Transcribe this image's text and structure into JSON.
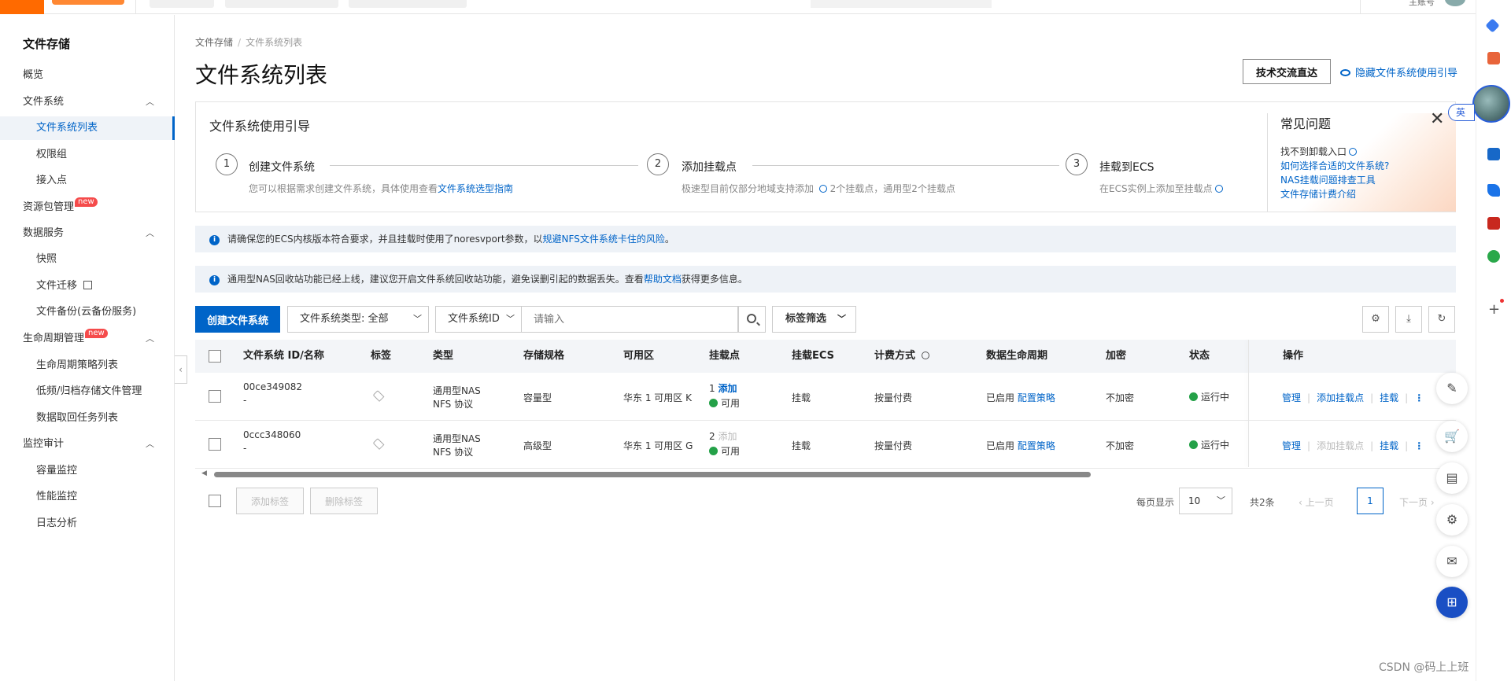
{
  "topbar": {
    "account_label": "主账号"
  },
  "sidebar": {
    "title": "文件存储",
    "items": [
      {
        "label": "概览"
      },
      {
        "label": "文件系统"
      },
      {
        "label": "文件系统列表"
      },
      {
        "label": "权限组"
      },
      {
        "label": "接入点"
      },
      {
        "label": "资源包管理",
        "badge": "new"
      },
      {
        "label": "数据服务"
      },
      {
        "label": "快照"
      },
      {
        "label": "文件迁移"
      },
      {
        "label": "文件备份(云备份服务)"
      },
      {
        "label": "生命周期管理",
        "badge": "new"
      },
      {
        "label": "生命周期策略列表"
      },
      {
        "label": "低频/归档存储文件管理"
      },
      {
        "label": "数据取回任务列表"
      },
      {
        "label": "监控审计"
      },
      {
        "label": "容量监控"
      },
      {
        "label": "性能监控"
      },
      {
        "label": "日志分析"
      }
    ]
  },
  "breadcrumb": {
    "root": "文件存储",
    "separator": "/",
    "current": "文件系统列表"
  },
  "page": {
    "title": "文件系统列表",
    "tech_button": "技术交流直达",
    "hide_guide": "隐藏文件系统使用引导"
  },
  "guide": {
    "title": "文件系统使用引导",
    "steps": [
      {
        "num": "1",
        "title": "创建文件系统",
        "desc": "您可以根据需求创建文件系统，具体使用查看",
        "link": "文件系统选型指南"
      },
      {
        "num": "2",
        "title": "添加挂载点",
        "desc": "极速型目前仅部分地域支持添加",
        "desc2": "2个挂载点，通用型2个挂载点"
      },
      {
        "num": "3",
        "title": "挂载到ECS",
        "desc": "在ECS实例上添加至挂载点"
      }
    ],
    "faq": {
      "title": "常见问题",
      "items": [
        "找不到卸载入口",
        "如何选择合适的文件系统?",
        "NAS挂载问题排查工具",
        "文件存储计费介绍"
      ]
    }
  },
  "notices": [
    {
      "text": "请确保您的ECS内核版本符合要求，并且挂载时使用了noresvport参数，以",
      "link": "规避NFS文件系统卡住的风险",
      "tail": "。"
    },
    {
      "text": "通用型NAS回收站功能已经上线，建议您开启文件系统回收站功能，避免误删引起的数据丢失。查看",
      "link": "帮助文档",
      "tail": "获得更多信息。"
    }
  ],
  "toolbar": {
    "create_button": "创建文件系统",
    "type_filter_label": "文件系统类型:",
    "type_filter_value": "全部",
    "id_filter": "文件系统ID",
    "search_placeholder": "请输入",
    "tag_filter": "标签筛选"
  },
  "table": {
    "headers": [
      "文件系统 ID/名称",
      "标签",
      "类型",
      "存储规格",
      "可用区",
      "挂载点",
      "挂载ECS",
      "计费方式",
      "数据生命周期",
      "加密",
      "状态",
      "操作"
    ],
    "rows": [
      {
        "id": "00ce349082",
        "name": "-",
        "type1": "通用型NAS",
        "type2": "NFS 协议",
        "spec": "容量型",
        "zone": "华东 1 可用区 K",
        "mount_count": "1",
        "mount_add": "添加",
        "mount_status": "可用",
        "ecs": "挂载",
        "billing": "按量付费",
        "lifecycle": "已启用",
        "lifecycle_link": "配置策略",
        "encryption": "不加密",
        "status": "运行中",
        "ops": [
          "管理",
          "添加挂载点",
          "挂载"
        ]
      },
      {
        "id": "0ccc348060",
        "name": "-",
        "type1": "通用型NAS",
        "type2": "NFS 协议",
        "spec": "高级型",
        "zone": "华东 1 可用区 G",
        "mount_count": "2",
        "mount_add": "添加",
        "mount_status": "可用",
        "ecs": "挂载",
        "billing": "按量付费",
        "lifecycle": "已启用",
        "lifecycle_link": "配置策略",
        "encryption": "不加密",
        "status": "运行中",
        "ops": [
          "管理",
          "添加挂载点",
          "挂载"
        ]
      }
    ]
  },
  "footer": {
    "add_tag": "添加标签",
    "remove_tag": "删除标签",
    "page_size_label": "每页显示",
    "page_size": "10",
    "total": "共2条",
    "prev": "上一页",
    "current_page": "1",
    "next": "下一页"
  },
  "rail": {
    "lang": "英"
  },
  "watermark": "CSDN @码上上班",
  "colors": {
    "primary": "#0064c8",
    "brand": "#ff6a00",
    "success": "#24a148",
    "new_badge": "#f54b4b"
  }
}
